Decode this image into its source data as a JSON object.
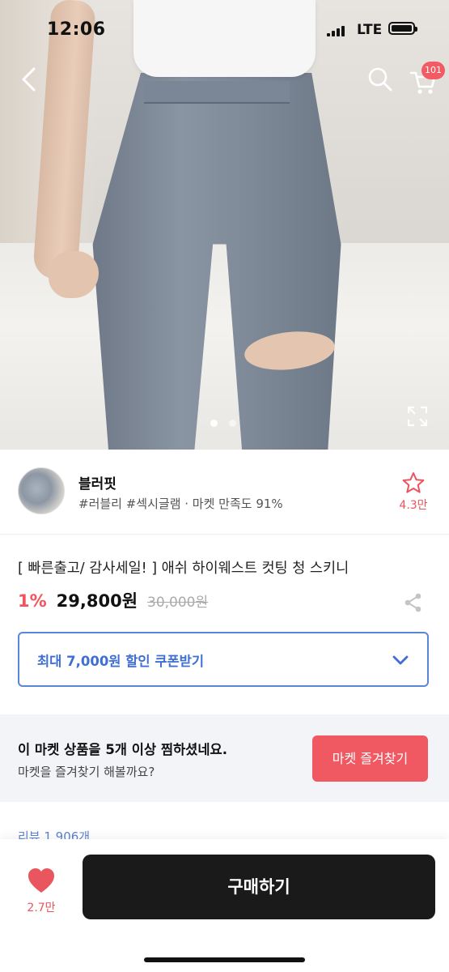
{
  "status_bar": {
    "time": "12:06",
    "network": "LTE"
  },
  "top_nav": {
    "back_icon": "chevron-left-icon",
    "search_icon": "search-icon",
    "cart_icon": "cart-icon",
    "cart_badge": "101"
  },
  "gallery": {
    "image_count": 2,
    "current_index": 1,
    "expand_icon": "expand-icon"
  },
  "seller": {
    "name": "블러핏",
    "tags": "#러블리 #섹시글램 · 마켓 만족도 91%",
    "favorite_icon": "star-outline-icon",
    "favorite_count": "4.3만"
  },
  "product": {
    "title": "[ 빠른출고/ 감사세일! ] 애쉬 하이웨스트 컷팅 청 스키니",
    "discount": "1%",
    "price": "29,800원",
    "original_price": "30,000원",
    "share_icon": "share-icon"
  },
  "coupon": {
    "label": "최대 7,000원 할인 쿠폰받기",
    "icon": "chevron-down-icon"
  },
  "market_banner": {
    "line1": "이 마켓 상품을 5개 이상 찜하셨네요.",
    "line2": "마켓을 즐겨찾기 해볼까요?",
    "button": "마켓 즐겨찾기"
  },
  "reviews_label": "리뷰 1,906개",
  "bottom_bar": {
    "like_icon": "heart-icon",
    "like_count": "2.7만",
    "buy_button": "구매하기"
  },
  "colors": {
    "accent_red": "#f05961",
    "coupon_blue": "#3f6fd1",
    "buy_button": "#1a1a1a",
    "banner_bg": "#f2f4f8"
  }
}
